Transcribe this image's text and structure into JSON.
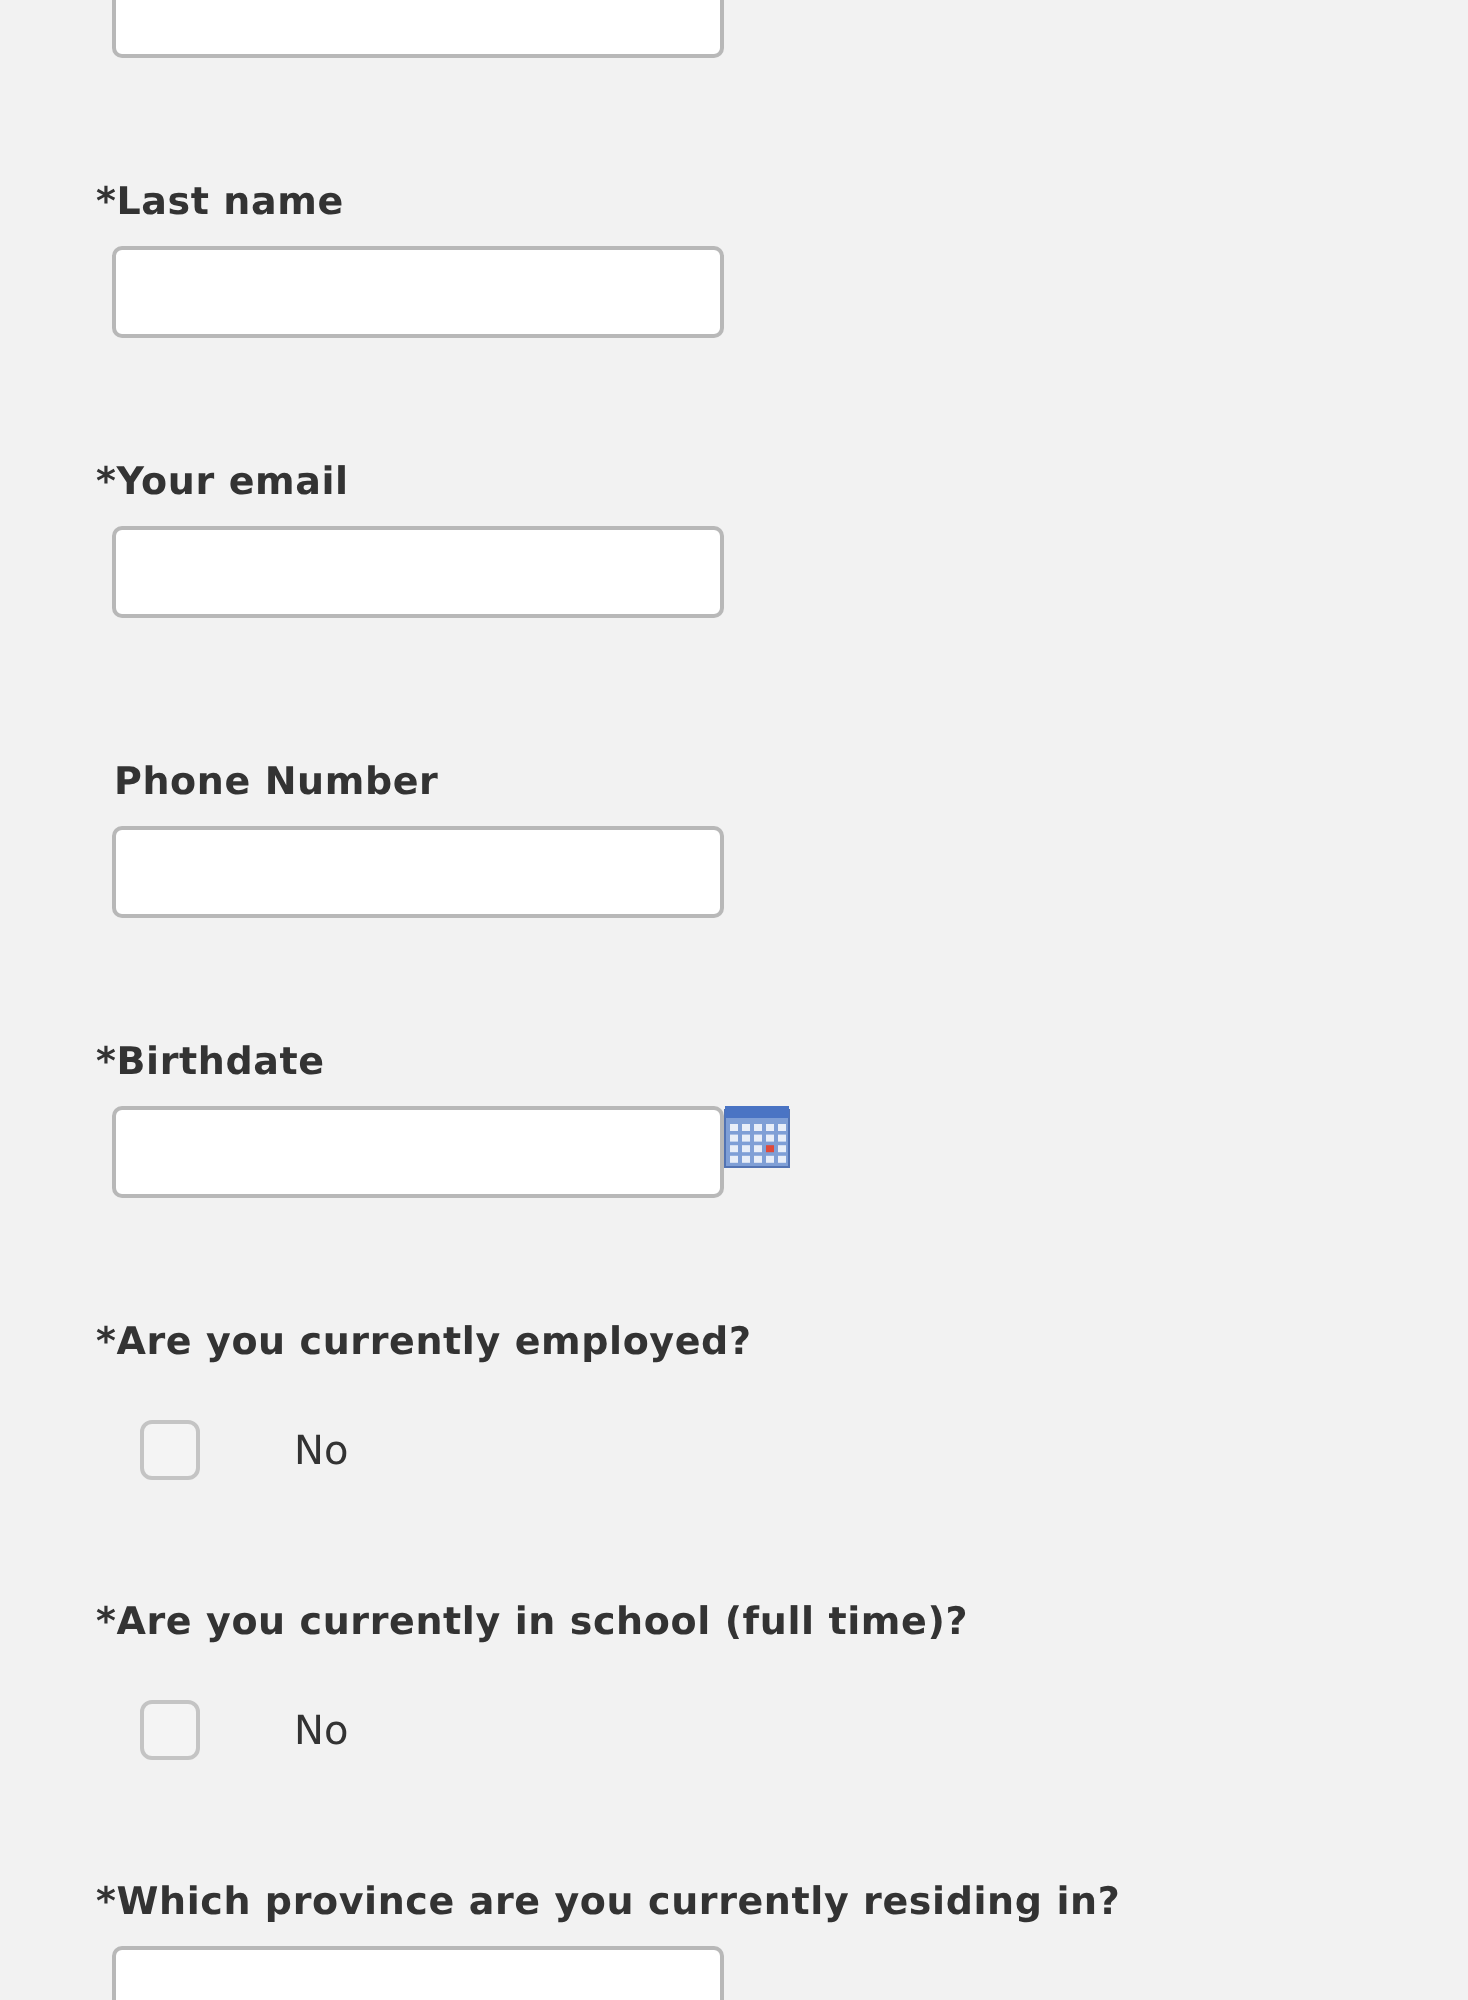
{
  "fields": [
    {
      "kind": "text"
    },
    {
      "kind": "text",
      "label": "*Last name",
      "required": true
    },
    {
      "kind": "text",
      "label": "*Your email",
      "required": true
    },
    {
      "kind": "text",
      "label": "Phone Number",
      "required": false
    },
    {
      "kind": "date",
      "label": "*Birthdate",
      "required": true
    },
    {
      "kind": "checkbox",
      "label": "*Are you currently employed?",
      "required": true,
      "options": [
        {
          "label": "No",
          "checked": false
        }
      ]
    },
    {
      "kind": "checkbox",
      "label": "*Are you currently in school (full time)?",
      "required": true,
      "options": [
        {
          "label": "No",
          "checked": false
        }
      ]
    },
    {
      "kind": "text",
      "label": "*Which province are you currently residing in?",
      "required": true
    }
  ]
}
